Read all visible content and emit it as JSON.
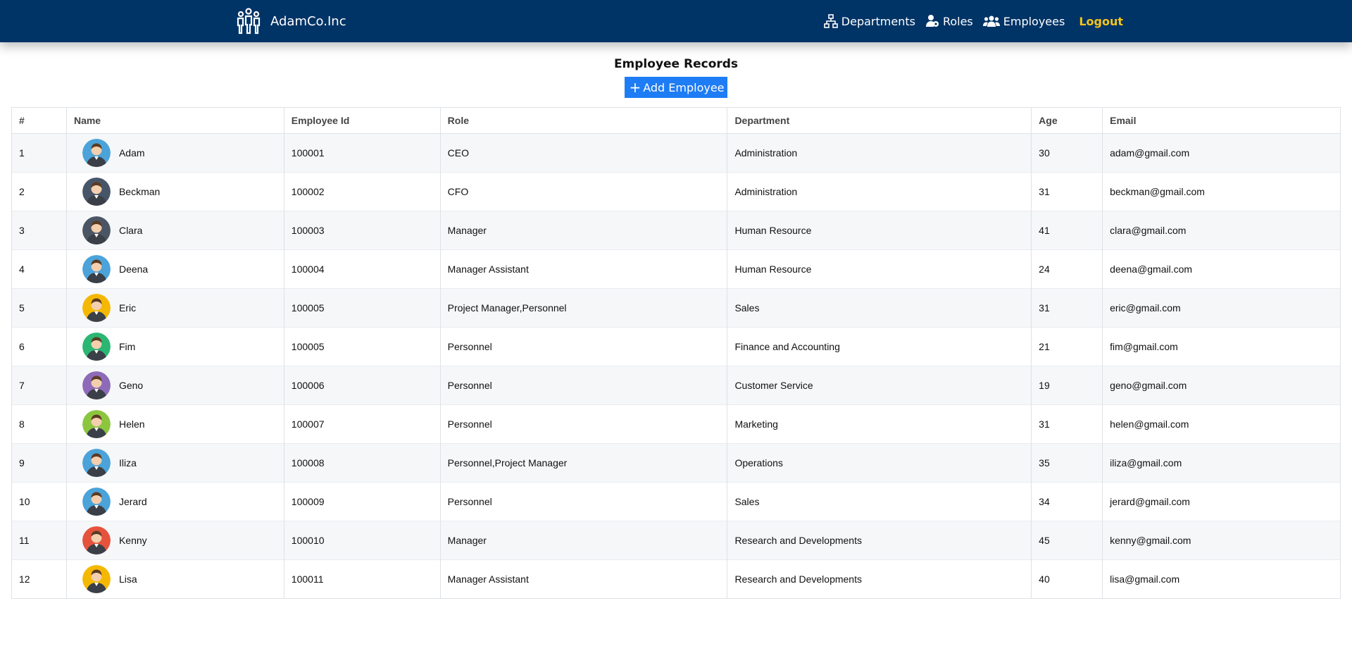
{
  "brand": {
    "name": "AdamCo.Inc"
  },
  "nav": {
    "departments": "Departments",
    "roles": "Roles",
    "employees": "Employees",
    "logout": "Logout"
  },
  "page": {
    "title": "Employee Records",
    "add_label": "Add Employee"
  },
  "table": {
    "headers": {
      "index": "#",
      "name": "Name",
      "employee_id": "Employee Id",
      "role": "Role",
      "department": "Department",
      "age": "Age",
      "email": "Email"
    },
    "rows": [
      {
        "index": "1",
        "name": "Adam",
        "employee_id": "100001",
        "role": "CEO",
        "department": "Administration",
        "age": "30",
        "email": "adam@gmail.com",
        "avatar_bg": "#4ba3d9"
      },
      {
        "index": "2",
        "name": "Beckman",
        "employee_id": "100002",
        "role": "CFO",
        "department": "Administration",
        "age": "31",
        "email": "beckman@gmail.com",
        "avatar_bg": "#475569"
      },
      {
        "index": "3",
        "name": "Clara",
        "employee_id": "100003",
        "role": "Manager",
        "department": "Human Resource",
        "age": "41",
        "email": "clara@gmail.com",
        "avatar_bg": "#4b5563"
      },
      {
        "index": "4",
        "name": "Deena",
        "employee_id": "100004",
        "role": "Manager Assistant",
        "department": "Human Resource",
        "age": "24",
        "email": "deena@gmail.com",
        "avatar_bg": "#4ba3d9"
      },
      {
        "index": "5",
        "name": "Eric",
        "employee_id": "100005",
        "role": "Project Manager,Personnel",
        "department": "Sales",
        "age": "31",
        "email": "eric@gmail.com",
        "avatar_bg": "#f5b800"
      },
      {
        "index": "6",
        "name": "Fim",
        "employee_id": "100005",
        "role": "Personnel",
        "department": "Finance and Accounting",
        "age": "21",
        "email": "fim@gmail.com",
        "avatar_bg": "#2bb673"
      },
      {
        "index": "7",
        "name": "Geno",
        "employee_id": "100006",
        "role": "Personnel",
        "department": "Customer Service",
        "age": "19",
        "email": "geno@gmail.com",
        "avatar_bg": "#8e6bb8"
      },
      {
        "index": "8",
        "name": "Helen",
        "employee_id": "100007",
        "role": "Personnel",
        "department": "Marketing",
        "age": "31",
        "email": "helen@gmail.com",
        "avatar_bg": "#8cc63f"
      },
      {
        "index": "9",
        "name": "Iliza",
        "employee_id": "100008",
        "role": "Personnel,Project Manager",
        "department": "Operations",
        "age": "35",
        "email": "iliza@gmail.com",
        "avatar_bg": "#4ba3d9"
      },
      {
        "index": "10",
        "name": "Jerard",
        "employee_id": "100009",
        "role": "Personnel",
        "department": "Sales",
        "age": "34",
        "email": "jerard@gmail.com",
        "avatar_bg": "#4ba3d9"
      },
      {
        "index": "11",
        "name": "Kenny",
        "employee_id": "100010",
        "role": "Manager",
        "department": "Research and Developments",
        "age": "45",
        "email": "kenny@gmail.com",
        "avatar_bg": "#e5533d"
      },
      {
        "index": "12",
        "name": "Lisa",
        "employee_id": "100011",
        "role": "Manager Assistant",
        "department": "Research and Developments",
        "age": "40",
        "email": "lisa@gmail.com",
        "avatar_bg": "#f5b800"
      }
    ]
  },
  "colors": {
    "navbar": "#003366",
    "logout": "#f5c518",
    "primary_button": "#1e7cf5"
  },
  "icons": {
    "brand": "people-group-logo-icon",
    "departments": "sitemap-icon",
    "roles": "user-gear-icon",
    "employees": "users-icon",
    "add": "plus-icon"
  }
}
